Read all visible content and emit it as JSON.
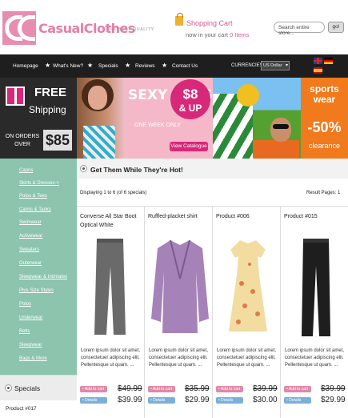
{
  "header": {
    "logo_text": "CC",
    "brand": "CasualClothes",
    "tagline": "THE BEST QUALITY",
    "cart_title": "Shopping Cart",
    "cart_sub_prefix": "now in your cart",
    "cart_count": "0 Items",
    "search_placeholder": "Search entire store...",
    "go_label": "go!"
  },
  "nav": {
    "items": [
      "Homepage",
      "What's New?",
      "Specials",
      "Reviews",
      "Contact Us"
    ],
    "star": "★",
    "currencies_label": "CURRENCIES:",
    "currency_value": "US Dollar"
  },
  "banners": {
    "free_word": "FREE",
    "shipping_word": "Shipping",
    "on_orders": "ON ORDERS OVER",
    "threshold": "$85",
    "sexy_tops": "SEXY TOPS",
    "one_week": "ONE WEEK ONLY",
    "price_circle": "$8",
    "price_circle_sub": "& UP",
    "view_catalogue": "View Catalogue",
    "sports_wear": "sports wear",
    "discount": "-50%",
    "clearance": "clearance"
  },
  "sidebar": {
    "categories": [
      "Capris",
      "Skirts & Dresses->",
      "Polos & Tees",
      "Camis & Tanks",
      "Swimwear",
      "Activewear",
      "Sweaters",
      "Outerwear",
      "Sleepwear & Intimates",
      "Plus Size Styles",
      "Polos",
      "Underwear",
      "Belts",
      "Sleepwear",
      "Bags & More"
    ],
    "specials_title": "Specials",
    "specials_product": "Product #017"
  },
  "main": {
    "hot_title": "Get Them While They're Hot!",
    "displaying": "Displaying 1 to 6 (of 6 specials)",
    "result_pages": "Result Pages:  1",
    "add_label": "• Add to cart",
    "details_label": "• Details",
    "products": [
      {
        "name": "Converse All Star Boot Optical White",
        "desc": "Lorem ipsum dolor sit amet, consectetuer adipiscing elit. Pellentesque ut quam. ...",
        "old": "$49.99",
        "new": "$39.99"
      },
      {
        "name": "Ruffled-placket shirt",
        "desc": "Lorem ipsum dolor sit amet, consectetuer adipiscing elit. Pellentesque ut quam. ...",
        "old": "$35.99",
        "new": "$29.99"
      },
      {
        "name": "Product #006",
        "desc": "Lorem ipsum dolor sit amet, consectetuer adipiscing elit. Pellentesque ut quam. ...",
        "old": "$39.99",
        "new": "$30.00"
      },
      {
        "name": "Product #015",
        "desc": "Lorem ipsum dolor sit amet, consectetuer adipiscing elit. Pellentesque ut quam. ...",
        "old": "$39.99",
        "new": "$29.99"
      }
    ]
  }
}
